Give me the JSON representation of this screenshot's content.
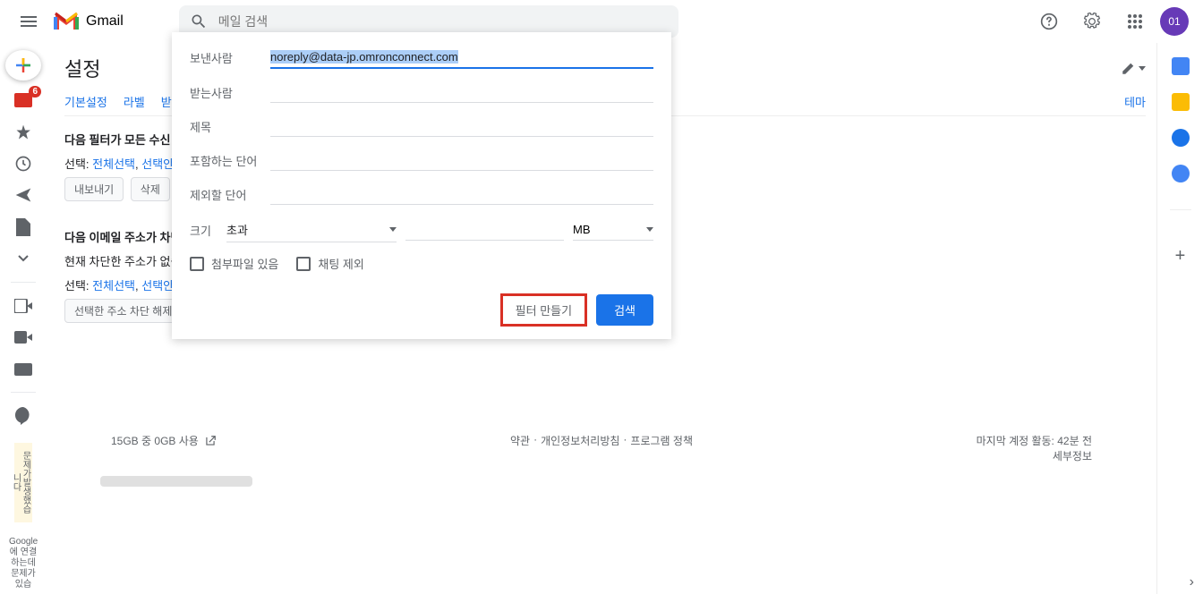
{
  "header": {
    "gmail_text": "Gmail",
    "search_placeholder": "메일 검색",
    "avatar_text": "01"
  },
  "left_rail": {
    "compose_plus": "+",
    "inbox_badge": "6",
    "warn_text": "문제가발생했습니다",
    "google_text": "Google에 연결하는데문제가있습"
  },
  "settings": {
    "title": "설정",
    "tabs": {
      "basic": "기본설정",
      "label": "라벨",
      "inbox": "받은편",
      "theme": "테마"
    },
    "section1": {
      "title": "다음 필터가 모든 수신 메일",
      "select_label": "선택:",
      "select_all": "전체선택",
      "select_none": "선택안함",
      "export": "내보내기",
      "delete": "삭제"
    },
    "section2": {
      "title": "다음 이메일 주소가 차단되",
      "desc": "현재 차단한 주소가 없습",
      "select_label": "선택:",
      "select_all": "전체선택",
      "select_none": "선택안함",
      "unblock": "선택한 주소 차단 해제"
    }
  },
  "search_form": {
    "from_label": "보낸사람",
    "from_value": "noreply@data-jp.omronconnect.com",
    "to_label": "받는사람",
    "subject_label": "제목",
    "hasword_label": "포함하는 단어",
    "noword_label": "제외할 단어",
    "size_label": "크기",
    "size_type": "초과",
    "size_unit": "MB",
    "attach_label": "첨부파일 있음",
    "chat_label": "채팅 제외",
    "create_filter": "필터 만들기",
    "search_btn": "검색"
  },
  "footer": {
    "storage": "15GB 중 0GB 사용",
    "terms": "약관",
    "privacy": "개인정보처리방침",
    "policy": "프로그램 정책",
    "activity": "마지막 계정 활동: 42분 전",
    "details": "세부정보"
  },
  "right_rail": {
    "colors": [
      "#4285f4",
      "#fbbc04",
      "#1a73e8",
      "#ea4335"
    ]
  }
}
